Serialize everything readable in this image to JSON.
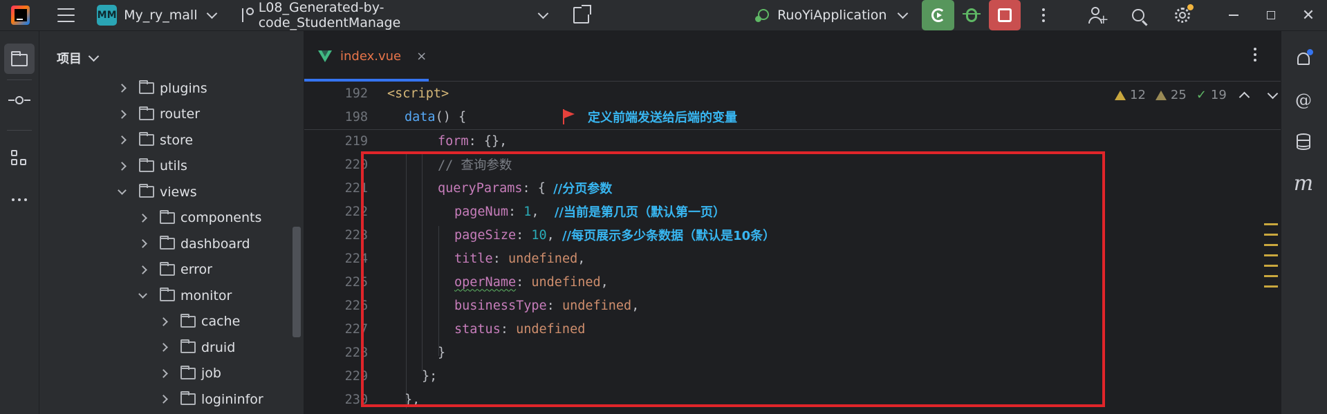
{
  "titlebar": {
    "project_badge": "MM",
    "project_name": "My_ry_mall",
    "branch": "L08_Generated-by-code_StudentManage",
    "run_config": "RuoYiApplication"
  },
  "project_panel": {
    "title": "项目",
    "tree": [
      {
        "label": "plugins",
        "state": "closed",
        "depth": 0
      },
      {
        "label": "router",
        "state": "closed",
        "depth": 0
      },
      {
        "label": "store",
        "state": "closed",
        "depth": 0
      },
      {
        "label": "utils",
        "state": "closed",
        "depth": 0
      },
      {
        "label": "views",
        "state": "open",
        "depth": 0
      },
      {
        "label": "components",
        "state": "closed",
        "depth": 1
      },
      {
        "label": "dashboard",
        "state": "closed",
        "depth": 1
      },
      {
        "label": "error",
        "state": "closed",
        "depth": 1
      },
      {
        "label": "monitor",
        "state": "open",
        "depth": 1
      },
      {
        "label": "cache",
        "state": "closed",
        "depth": 2
      },
      {
        "label": "druid",
        "state": "closed",
        "depth": 2
      },
      {
        "label": "job",
        "state": "closed",
        "depth": 2
      },
      {
        "label": "logininfor",
        "state": "closed",
        "depth": 2
      }
    ]
  },
  "editor": {
    "tab_label": "index.vue",
    "tab_close": "×",
    "inspections": {
      "errors": "12",
      "warnings": "25",
      "weak": "19"
    },
    "sticky": {
      "line1_num": "192",
      "line1_tag": "<script>",
      "line2_num": "198",
      "line2_fn": "data",
      "line2_rest": "() {",
      "annotation": "定义前端发送给后端的变量"
    },
    "lines": {
      "l219": {
        "num": "219",
        "prop": "form",
        "rest": ": {},"
      },
      "l220": {
        "num": "220",
        "comment": "// 查询参数"
      },
      "l221": {
        "num": "221",
        "prop": "queryParams",
        "rest": ": { ",
        "ann": "//分页参数"
      },
      "l222": {
        "num": "222",
        "prop": "pageNum",
        "colon": ": ",
        "val": "1",
        "comma": ",  ",
        "ann": "//当前是第几页（默认第一页）"
      },
      "l223": {
        "num": "223",
        "prop": "pageSize",
        "colon": ": ",
        "val": "10",
        "comma": ", ",
        "ann": "//每页展示多少条数据（默认是10条）"
      },
      "l224": {
        "num": "224",
        "prop": "title",
        "colon": ": ",
        "val": "undefined",
        "comma": ","
      },
      "l225": {
        "num": "225",
        "prop": "operName",
        "colon": ": ",
        "val": "undefined",
        "comma": ","
      },
      "l226": {
        "num": "226",
        "prop": "businessType",
        "colon": ": ",
        "val": "undefined",
        "comma": ","
      },
      "l227": {
        "num": "227",
        "prop": "status",
        "colon": ": ",
        "val": "undefined"
      },
      "l228": {
        "num": "228",
        "text": "}"
      },
      "l229": {
        "num": "229",
        "text": "};"
      },
      "l230": {
        "num": "230",
        "text": "},"
      }
    }
  },
  "colors": {
    "accent": "#3574f0",
    "run_green": "#57965c",
    "stop_red": "#c94f4f",
    "highlight_box": "#e0252a",
    "annotation_blue": "#38b6f1"
  },
  "icons": [
    "ide-logo-icon",
    "menu-icon",
    "branch-icon",
    "open-external-icon",
    "run-config-icon",
    "rerun-icon",
    "debug-icon",
    "stop-icon",
    "more-icon",
    "add-user-icon",
    "search-icon",
    "gear-icon",
    "minimize-icon",
    "maximize-icon",
    "close-icon",
    "folder-icon",
    "commit-icon",
    "structure-icon",
    "vue-icon",
    "flag-icon",
    "bell-icon",
    "ai-assistant-icon",
    "database-icon",
    "maven-icon"
  ]
}
